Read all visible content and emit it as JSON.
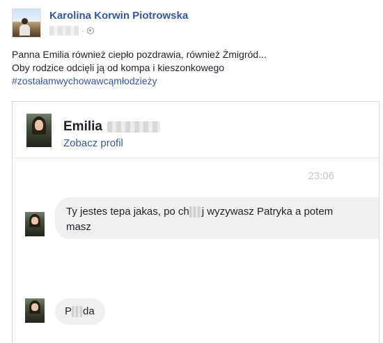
{
  "post": {
    "author_name": "Karolina Korwin Piotrowska",
    "meta_separator": "·",
    "text_line1": "Panna Emilia również ciepło pozdrawia, również Żmigród...",
    "text_line2": "Oby rodzice odcięli ją od kompa i kieszonkowego",
    "hashtag": "#zostałamwychowawcąmłodzieży"
  },
  "chat": {
    "contact_first_name": "Emilia",
    "view_profile_label": "Zobacz profil",
    "timestamp": "23:06",
    "messages": [
      {
        "text_before": "Ty jestes tepa jakas, po ch",
        "text_after": "j wyzywasz Patryka a potem",
        "text_line2": "masz"
      },
      {
        "text_before": "P",
        "text_after": "da"
      }
    ]
  },
  "colors": {
    "link_blue": "#365899",
    "bubble_gray": "#f1f0f0",
    "timestamp_gray": "#c8c8c8"
  }
}
